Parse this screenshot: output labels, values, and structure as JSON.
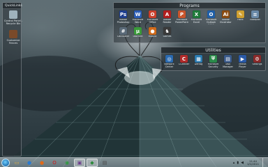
{
  "fences": {
    "quicklinks": {
      "title": "QuickLinks",
      "items": [
        {
          "label": "Control Panel - Recycle Bin",
          "icon": "recycle-bin-icon",
          "color": "#9fb3bd"
        },
        {
          "label": "Customize Fences",
          "icon": "fences-icon",
          "color": "#7a4a2a"
        }
      ]
    },
    "programs": {
      "title": "Programs",
      "items": [
        {
          "label": "Adobe Photoshop",
          "icon": "photoshop-icon",
          "color": "#1f3f8f",
          "glyph": "Ps"
        },
        {
          "label": "Microsoft Word",
          "icon": "word-icon",
          "color": "#2b5db5",
          "glyph": "W"
        },
        {
          "label": "Microsoft Office",
          "icon": "office-icon",
          "color": "#c9402c",
          "glyph": "O"
        },
        {
          "label": "Adobe Reader",
          "icon": "acrobat-icon",
          "color": "#b01e1e",
          "glyph": "A"
        },
        {
          "label": "Microsoft PowerPoint",
          "icon": "powerpoint-icon",
          "color": "#c9552c",
          "glyph": "P"
        },
        {
          "label": "Microsoft Excel",
          "icon": "excel-icon",
          "color": "#1f7a3a",
          "glyph": "X"
        },
        {
          "label": "Microsoft Outlook 2010",
          "icon": "outlook-icon",
          "color": "#1f5fa8",
          "glyph": "O"
        },
        {
          "label": "Adobe Illustrator",
          "icon": "illustrator-icon",
          "color": "#8a4a10",
          "glyph": "Ai"
        },
        {
          "label": "Paint",
          "icon": "paint-icon",
          "color": "#d0a030",
          "glyph": "✎"
        },
        {
          "label": "Notepad",
          "icon": "notepad-icon",
          "color": "#6a8aa8",
          "glyph": "≡"
        },
        {
          "label": "Calculator",
          "icon": "calculator-icon",
          "color": "#5a6a78",
          "glyph": "#"
        },
        {
          "label": "Utorrent",
          "icon": "utorrent-icon",
          "color": "#3a9a3a",
          "glyph": "µ"
        },
        {
          "label": "Mozilla",
          "icon": "firefox-icon",
          "color": "#d06a1a",
          "glyph": "●"
        },
        {
          "label": "Games",
          "icon": "games-icon",
          "color": "#3a3a3a",
          "glyph": "♞"
        }
      ]
    },
    "utilities": {
      "title": "Utilities",
      "items": [
        {
          "label": "Network Center",
          "icon": "network-icon",
          "color": "#2a6ab0",
          "glyph": "◎"
        },
        {
          "label": "CCleaner",
          "icon": "ccleaner-icon",
          "color": "#b02a2a",
          "glyph": "C"
        },
        {
          "label": "Defrag",
          "icon": "defrag-icon",
          "color": "#2a7ab0",
          "glyph": "▦"
        },
        {
          "label": "Microsoft Security",
          "icon": "security-icon",
          "color": "#2a8a4a",
          "glyph": "⛨"
        },
        {
          "label": "Task Manager",
          "icon": "taskmgr-icon",
          "color": "#3a5a8a",
          "glyph": "▤"
        },
        {
          "label": "Media Player",
          "icon": "media-player-icon",
          "color": "#2a5aa8",
          "glyph": "▶"
        },
        {
          "label": "Settings",
          "icon": "settings-icon",
          "color": "#8a2a2a",
          "glyph": "⚙"
        }
      ]
    }
  },
  "taskbar": {
    "buttons": [
      {
        "name": "explorer-button",
        "icon": "folder-icon",
        "glyph": "▭",
        "color": "#e0b040"
      },
      {
        "name": "media-button",
        "icon": "media-icon",
        "glyph": "●",
        "color": "#2a7ad0"
      },
      {
        "name": "firefox-button",
        "icon": "firefox-icon",
        "glyph": "●",
        "color": "#e06a1a"
      },
      {
        "name": "opera-button",
        "icon": "opera-icon",
        "glyph": "O",
        "color": "#d01a1a"
      },
      {
        "name": "chrome-button",
        "icon": "chrome-icon",
        "glyph": "◉",
        "color": "#2a9a3a"
      },
      {
        "name": "app-button-active",
        "icon": "window-icon",
        "glyph": "▣",
        "color": "#6a3a8a",
        "active": true
      },
      {
        "name": "app-button-2",
        "icon": "app-icon",
        "glyph": "◆",
        "color": "#2a8a3a",
        "active": true
      },
      {
        "name": "app-button-3",
        "icon": "document-icon",
        "glyph": "▤",
        "color": "#4a4a4a"
      }
    ],
    "clock": {
      "time": "11:44",
      "date": "1/1/2011"
    }
  }
}
